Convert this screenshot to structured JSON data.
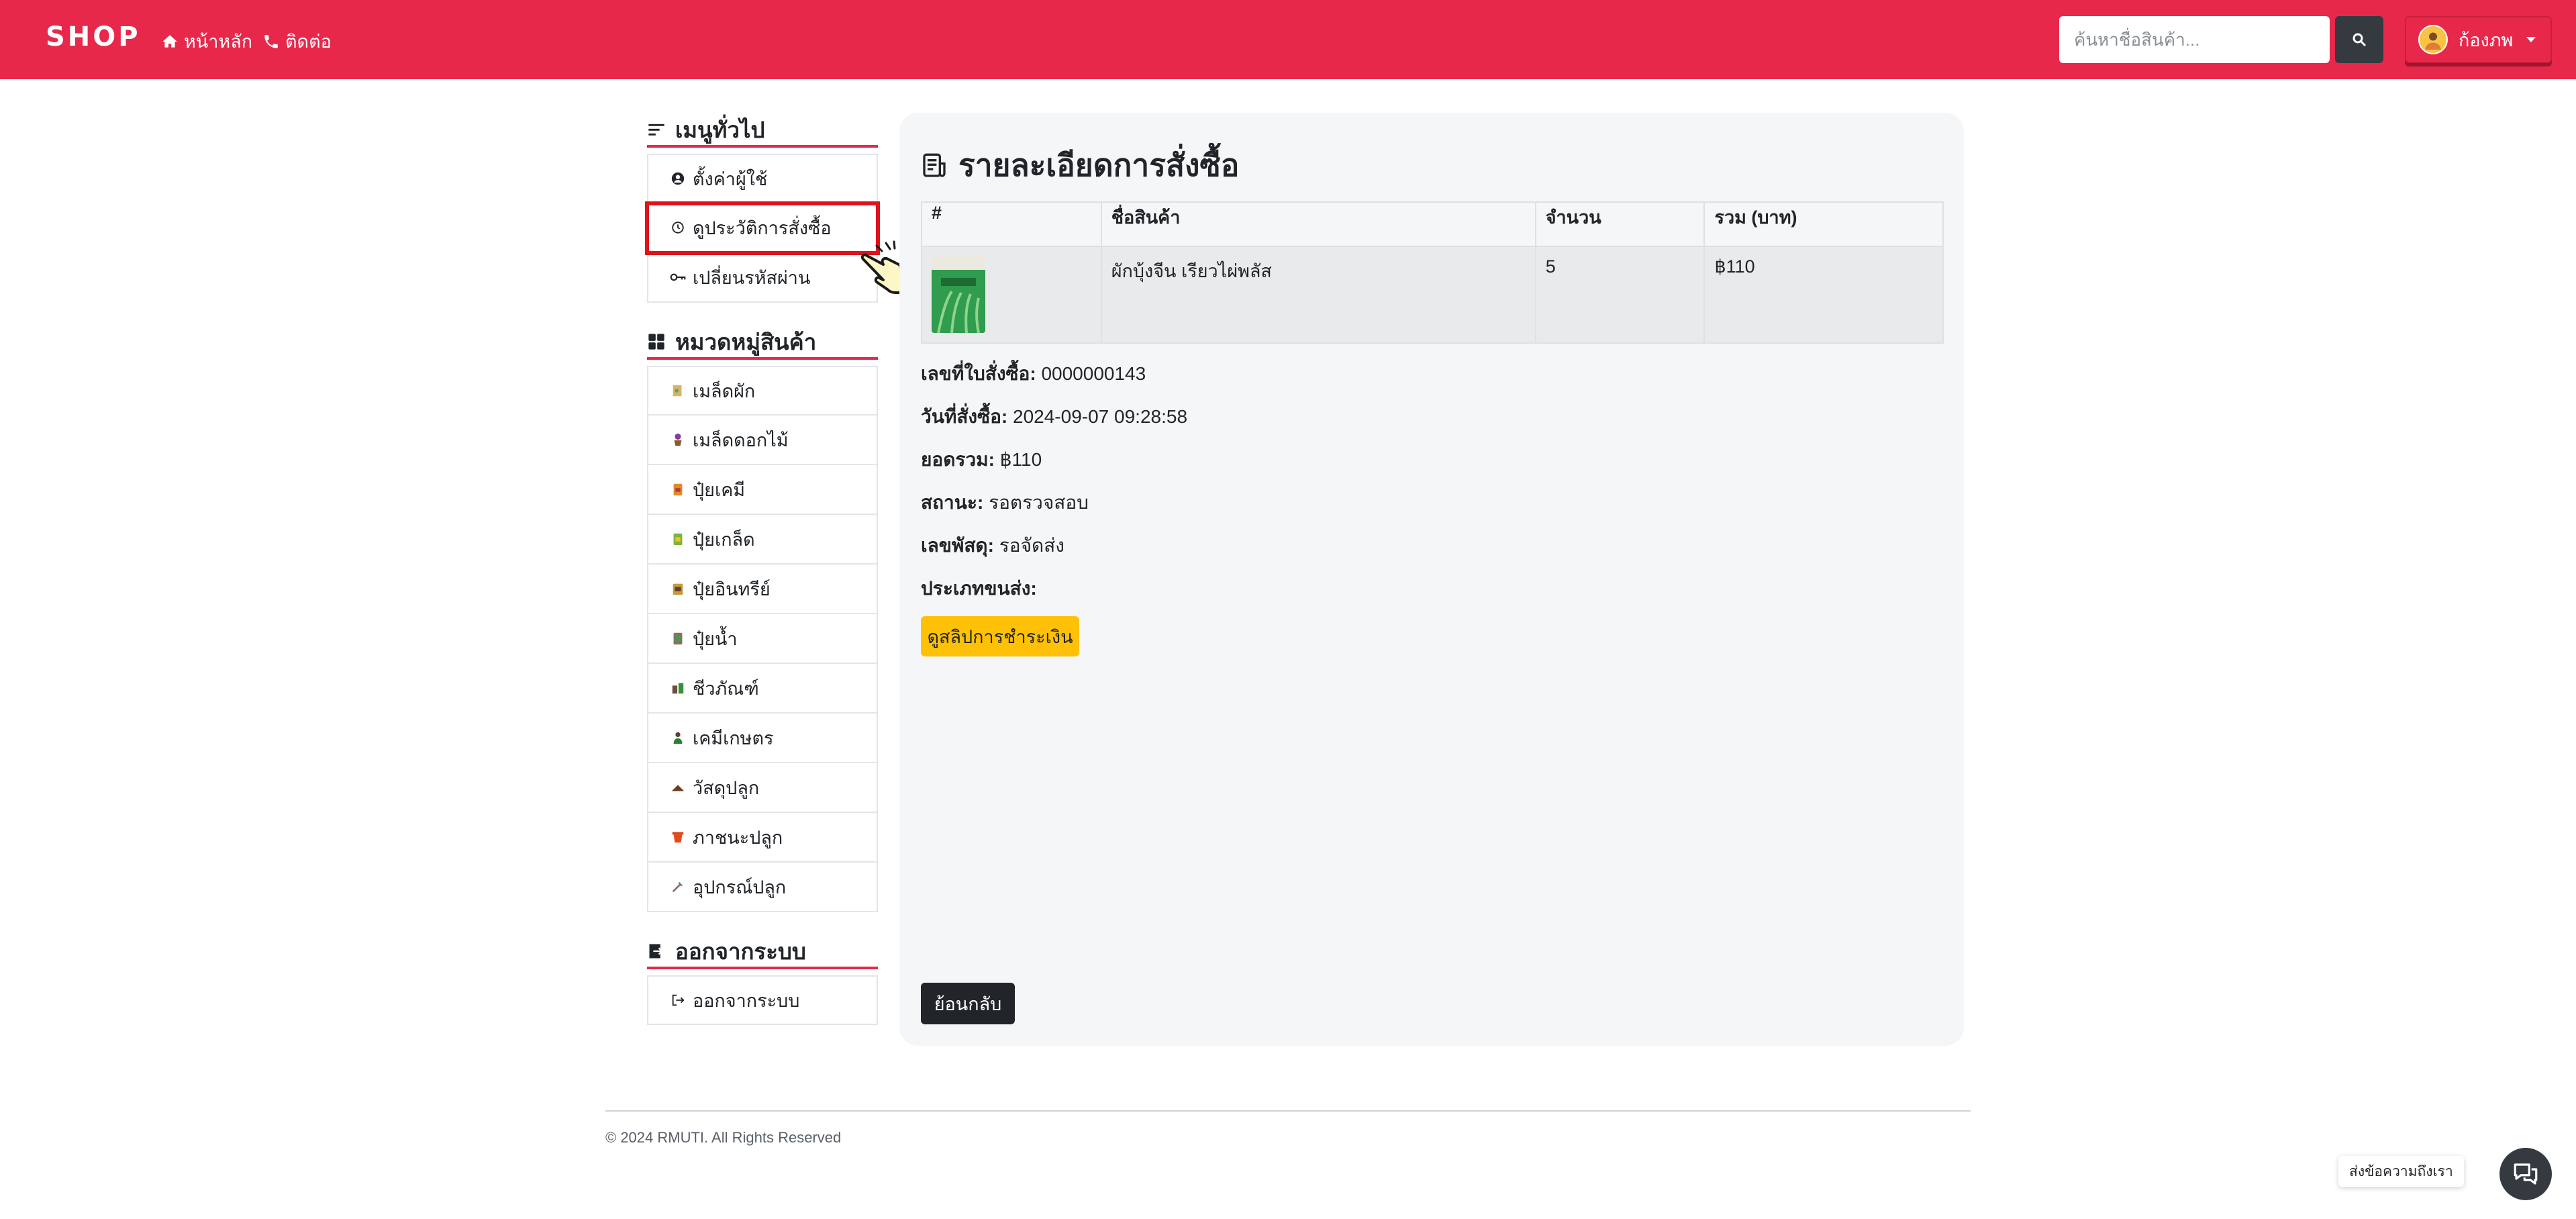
{
  "navbar": {
    "brand": "SHOP",
    "home": "หน้าหลัก",
    "contact": "ติดต่อ",
    "search_placeholder": "ค้นหาชื่อสินค้า...",
    "user_name": "ก้องภพ"
  },
  "sidebar": {
    "general_heading": "เมนูทั่วไป",
    "general_items": [
      {
        "label": "ตั้งค่าผู้ใช้",
        "icon": "user-circle-icon"
      },
      {
        "label": "ดูประวัติการสั่งซื้อ",
        "icon": "history-icon"
      },
      {
        "label": "เปลี่ยนรหัสผ่าน",
        "icon": "key-icon"
      }
    ],
    "category_heading": "หมวดหมู่สินค้า",
    "category_items": [
      {
        "label": "เมล็ดผัก",
        "icon": "seed-packet-icon"
      },
      {
        "label": "เมล็ดดอกไม้",
        "icon": "flower-pot-icon"
      },
      {
        "label": "ปุ๋ยเคมี",
        "icon": "fertilizer-bag-icon"
      },
      {
        "label": "ปุ๋ยเกล็ด",
        "icon": "fertilizer-flakes-icon"
      },
      {
        "label": "ปุ๋ยอินทรีย์",
        "icon": "organic-fertilizer-icon"
      },
      {
        "label": "ปุ๋ยน้ำ",
        "icon": "liquid-fertilizer-icon"
      },
      {
        "label": "ชีวภัณฑ์",
        "icon": "bio-product-icon"
      },
      {
        "label": "เคมีเกษตร",
        "icon": "farm-chemical-icon"
      },
      {
        "label": "วัสดุปลูก",
        "icon": "soil-icon"
      },
      {
        "label": "ภาชนะปลูก",
        "icon": "pot-icon"
      },
      {
        "label": "อุปกรณ์ปลูก",
        "icon": "tool-icon"
      }
    ],
    "logout_heading": "ออกจากระบบ",
    "logout_item": "ออกจากระบบ"
  },
  "main": {
    "title": "รายละเอียดการสั่งซื้อ",
    "table": {
      "headers": [
        "#",
        "ชื่อสินค้า",
        "จำนวน",
        "รวม (บาท)"
      ],
      "rows": [
        {
          "product": "ผักบุ้งจีน เรียวไผ่พลัส",
          "qty": "5",
          "total": "฿110"
        }
      ]
    },
    "details": {
      "order_no_label": "เลขที่ใบสั่งซื้อ:",
      "order_no": "0000000143",
      "order_date_label": "วันที่สั่งซื้อ:",
      "order_date": "2024-09-07 09:28:58",
      "total_label": "ยอดรวม:",
      "total": "฿110",
      "status_label": "สถานะ:",
      "status": "รอตรวจสอบ",
      "tracking_label": "เลขพัสดุ:",
      "tracking": "รอจัดส่ง",
      "shipping_label": "ประเภทขนส่ง:",
      "shipping": ""
    },
    "view_slip_button": "ดูสลิปการชำระเงิน",
    "back_button": "ย้อนกลับ"
  },
  "footer": {
    "copyright": "© 2024 RMUTI. All Rights Reserved"
  },
  "chat": {
    "label": "ส่งข้อความถึงเรา"
  },
  "colors": {
    "brand_red": "#e8284a",
    "highlight_red": "#e0131c",
    "yellow": "#ffc107",
    "dark": "#212529"
  }
}
